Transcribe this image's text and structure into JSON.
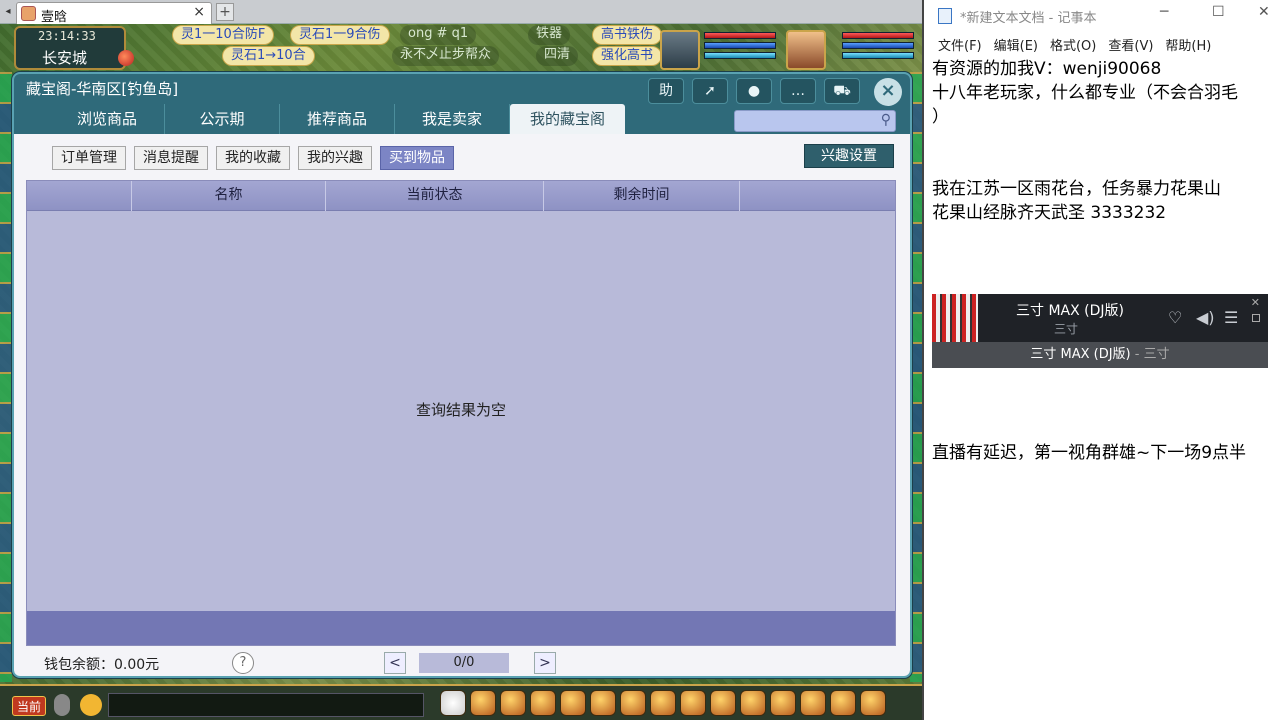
{
  "browser": {
    "tab_title": "壹晗",
    "tab_close": "×",
    "new_tab": "+"
  },
  "hud": {
    "time": "23:14:33",
    "city": "长安城",
    "announcements": [
      "灵1一10合防F",
      "灵石1一9合伤",
      "ong # q1",
      "铁器",
      "高书铁伤",
      "灵石1→10合",
      "永不乄止步帮众",
      "四清",
      "强化高书"
    ]
  },
  "dialog": {
    "title": "藏宝阁-华南区[钓鱼岛]",
    "tools": {
      "help": "助",
      "close": "×"
    },
    "tabs": [
      "浏览商品",
      "公示期",
      "推荐商品",
      "我是卖家",
      "我的藏宝阁"
    ],
    "active_tab": 4,
    "subtabs": [
      "订单管理",
      "消息提醒",
      "我的收藏",
      "我的兴趣",
      "买到物品"
    ],
    "active_subtab": 4,
    "interest_settings": "兴趣设置",
    "table": {
      "columns": [
        "名称",
        "当前状态",
        "剩余时间"
      ],
      "empty_message": "查询结果为空"
    },
    "wallet": "钱包余额：0.00元",
    "help": "?",
    "pagination": {
      "prev": "<",
      "label": "0/0",
      "next": ">"
    }
  },
  "bottom_bar": {
    "current": "当前"
  },
  "notepad": {
    "title": "*新建文本文档 - 记事本",
    "menu": [
      "文件(F)",
      "编辑(E)",
      "格式(O)",
      "查看(V)",
      "帮助(H)"
    ],
    "lines": [
      "有资源的加我V：wenji90068",
      "十八年老玩家，什么都专业（不会合羽毛",
      "）",
      "我在江苏一区雨花台，任务暴力花果山",
      "花果山经脉齐天武圣 3333232",
      "直播有延迟，第一视角群雄~下一场9点半"
    ]
  },
  "music": {
    "title": "三寸 MAX (DJ版)",
    "artist": "三寸",
    "strip_song": "三寸 MAX (DJ版)",
    "strip_sep": " - ",
    "strip_artist": "三寸"
  }
}
